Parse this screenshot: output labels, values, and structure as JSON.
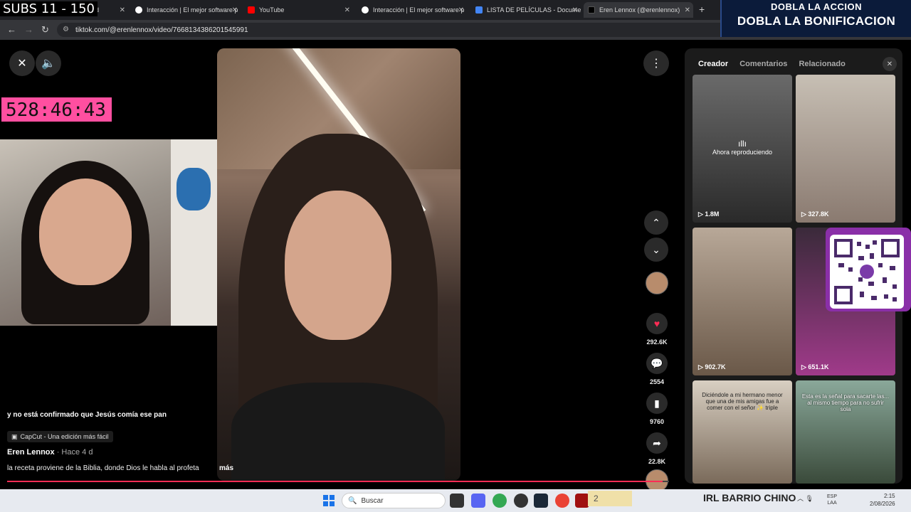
{
  "browser": {
    "tabs": [
      {
        "label": "ard"
      },
      {
        "label": "Interacción | El mejor software p"
      },
      {
        "label": "YouTube"
      },
      {
        "label": "Interacción | El mejor software p"
      },
      {
        "label": "LISTA DE PELÍCULAS - Documen"
      },
      {
        "label": "Eren Lennox (@erenlennox)"
      }
    ],
    "url": "tiktok.com/@erenlennox/video/7668134386201545991"
  },
  "overlay": {
    "subs": "SUBS 11 - 150",
    "banner_line1": "DOBLA LA ACCION",
    "banner_line2": "DOBLA LA BONIFICACION",
    "timer": "528:46:43"
  },
  "video": {
    "caption": "y no está confirmado que Jesús comía ese pan",
    "capcut": "CapCut - Una edición más fácil",
    "author": "Eren Lennox",
    "posted": "· Hace 4 d",
    "description": "la receta proviene de la Biblia, donde Dios le habla al profeta",
    "more": "más",
    "progress": 0.99,
    "likes": "292.6K",
    "comments": "2554",
    "saves": "9760",
    "shares": "22.8K"
  },
  "panel": {
    "tabs": [
      "Creador",
      "Comentarios",
      "Relacionado"
    ],
    "now_playing": "Ahora reproduciendo",
    "thumbs": [
      {
        "views": "1.8M",
        "text": ""
      },
      {
        "views": "327.8K",
        "text": ""
      },
      {
        "views": "902.7K",
        "text": ""
      },
      {
        "views": "651.1K",
        "text": ""
      },
      {
        "views": "",
        "text": "Diciéndole a mi hermano menor que una de mis amigas fue a comer con el señor ✨ triple"
      },
      {
        "views": "",
        "text": "Esta es la señal para sacarte las... al mismo tiempo para no sufrir sola"
      }
    ]
  },
  "taskbar": {
    "search": "Buscar",
    "badge": "2",
    "stream_label": "IRL BARRIO CHINO",
    "lang": "ESP\nLAA",
    "time": "2:15",
    "date": "2/08/2026"
  },
  "colors": {
    "accent": "#fe2c55",
    "timer_bg": "#ff4fa0",
    "banner_bg": "#0b1b3a"
  }
}
